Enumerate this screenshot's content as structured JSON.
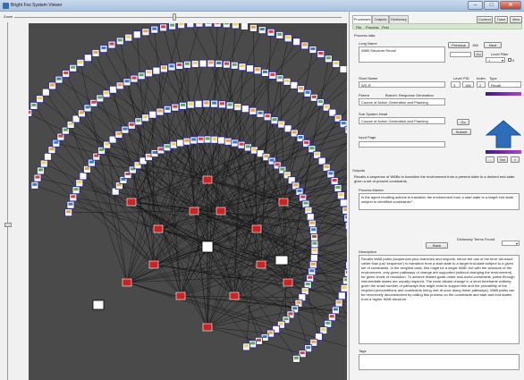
{
  "window": {
    "title": "Bright Fox System Viewer",
    "minimize": "–",
    "maximize": "□",
    "close": "✕"
  },
  "zoom": {
    "label": "Zoom",
    "value": 0.5
  },
  "tabs": [
    {
      "label": "Processes",
      "active": true
    },
    {
      "label": "Outputs",
      "active": false
    },
    {
      "label": "Dictionary",
      "active": false
    }
  ],
  "top_buttons": {
    "context": "Context",
    "trace": "Trace",
    "view": "View"
  },
  "menu": {
    "file": "File",
    "process": "Process",
    "find": "Find"
  },
  "section_title": "Process data",
  "long_name": {
    "label": "Long Name",
    "value": "WAB Structure Recall"
  },
  "nav": {
    "previous": "Previous",
    "count": "156",
    "next": "Next",
    "go": "Go",
    "level_filter_label": "Level Filter",
    "level_filter_value": "3",
    "level_checkbox_label": "0"
  },
  "short_name": {
    "label": "Short Name",
    "value": "WS-R"
  },
  "level": {
    "label": "Level",
    "value": "3"
  },
  "pid": {
    "label": "PID",
    "value": "186"
  },
  "index": {
    "label": "Index",
    "value": "2"
  },
  "type": {
    "label": "Type",
    "value": "Recall"
  },
  "parent": {
    "label": "Parent",
    "branch_label": "Branch: Response Generation",
    "value": "Course of Action Generation and Planning"
  },
  "subsystem": {
    "label": "Sub System Head",
    "value": "Course of Action Generation and Planning",
    "go": "Go",
    "submit": "Submit"
  },
  "input_page": {
    "label": "Input Page",
    "value": ""
  },
  "arrow_buttons": {
    "left": "...",
    "mid": "Set",
    "right": ">"
  },
  "outputs": {
    "label": "Outputs",
    "text": "Recalls a sequence of WABs to transition the environment from a present state to a desired end-state given a set of present constraints."
  },
  "process_marker": {
    "label": "Process Marker",
    "text": "Is the agent recalling actions to transition the environment from a start state to a target end state subject to identified constraints?"
  },
  "dictionary": {
    "label": "Dictionary Terms Found",
    "back": "Back"
  },
  "description": {
    "label": "Description",
    "text": "Recalls WAB paths (sequences plus branches and sequels, hence the use of the term 'structure' rather than just 'sequence') to transition from a start state to a target end-state subject to a given set of constraints. In the simplest case, this might be a single WAB, but with the structure of the environment, only given pathways of change are supported (without changing the environment) for given levels of resolution. To achieve distant goals under real-world constraints, paths through intermediate states are usually required. The more distant change in a short timeframe unlikely, given the small number of pathways that might exist to support this and the probability of the required preconditions and constraints being met at once along these pathways). WAB paths can be recursively deconstructed by calling this process on the constraints and start and end-states from a higher WAB structure."
  },
  "tags": {
    "label": "Tags",
    "value": ""
  },
  "colors": {
    "canvas_bg": "#4a4a4a",
    "arrow_blue": "#2e6db8",
    "node_red": "#cc2222",
    "accent_purple": "#8a3cc6"
  }
}
